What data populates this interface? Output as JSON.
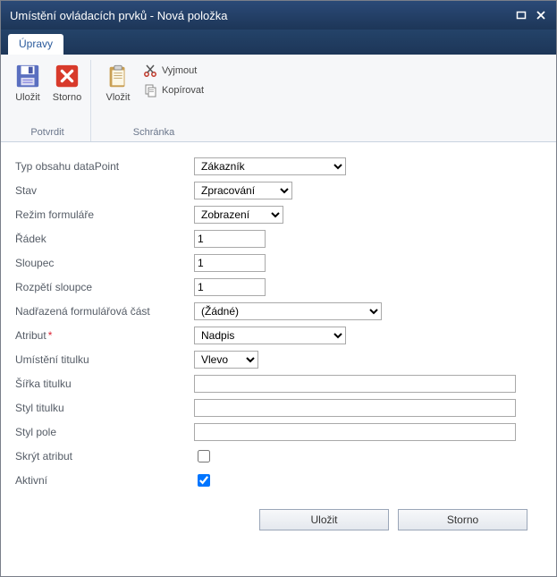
{
  "titlebar": {
    "text": "Umístění ovládacích prvků - Nová položka"
  },
  "tabs": {
    "edit": "Úpravy"
  },
  "ribbon": {
    "group_confirm": {
      "label": "Potvrdit",
      "save": "Uložit",
      "cancel": "Storno"
    },
    "group_clipboard": {
      "label": "Schránka",
      "paste": "Vložit",
      "cut": "Vyjmout",
      "copy": "Kopírovat"
    }
  },
  "form": {
    "datapoint_type": {
      "label": "Typ obsahu dataPoint",
      "value": "Zákazník"
    },
    "state": {
      "label": "Stav",
      "value": "Zpracování"
    },
    "form_mode": {
      "label": "Režim formuláře",
      "value": "Zobrazení"
    },
    "row": {
      "label": "Řádek",
      "value": "1"
    },
    "column": {
      "label": "Sloupec",
      "value": "1"
    },
    "colspan": {
      "label": "Rozpětí sloupce",
      "value": "1"
    },
    "parent_part": {
      "label": "Nadřazená formulářová část",
      "value": "(Žádné)"
    },
    "attribute": {
      "label": "Atribut",
      "required": "*",
      "value": "Nadpis"
    },
    "caption_pos": {
      "label": "Umístění titulku",
      "value": "Vlevo"
    },
    "caption_width": {
      "label": "Šířka titulku",
      "value": ""
    },
    "caption_style": {
      "label": "Styl titulku",
      "value": ""
    },
    "field_style": {
      "label": "Styl pole",
      "value": ""
    },
    "hide_attr": {
      "label": "Skrýt atribut",
      "checked": false
    },
    "active": {
      "label": "Aktivní",
      "checked": true
    }
  },
  "buttons": {
    "save": "Uložit",
    "cancel": "Storno"
  }
}
